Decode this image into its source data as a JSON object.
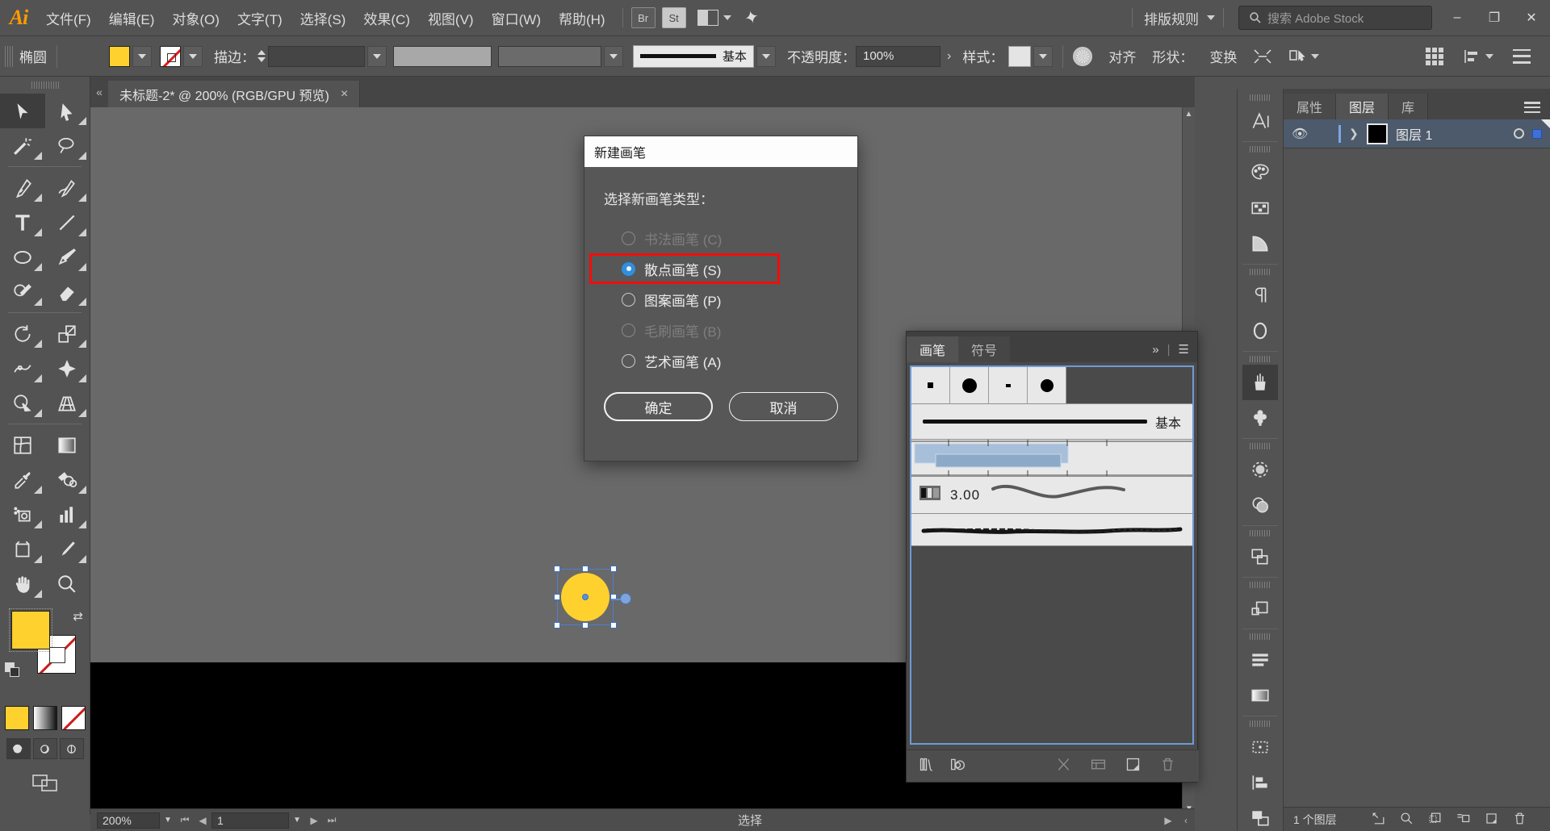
{
  "app": {
    "name": "Adobe Illustrator",
    "logo_text": "Ai",
    "workspace_label": "排版规则",
    "br_badge": "Br",
    "st_badge": "St"
  },
  "menu": {
    "items": [
      {
        "label": "文件(F)"
      },
      {
        "label": "编辑(E)"
      },
      {
        "label": "对象(O)"
      },
      {
        "label": "文字(T)"
      },
      {
        "label": "选择(S)"
      },
      {
        "label": "效果(C)"
      },
      {
        "label": "视图(V)"
      },
      {
        "label": "窗口(W)"
      },
      {
        "label": "帮助(H)"
      }
    ]
  },
  "search": {
    "placeholder": "搜索 Adobe Stock",
    "value": ""
  },
  "window_controls": {
    "minimize": "–",
    "restore": "❐",
    "close": "✕"
  },
  "control_bar": {
    "object_type": "椭圆",
    "fill_color": "#FFD12E",
    "stroke_color": "none",
    "stroke_label": "描边：",
    "stroke_weight": "",
    "brush_name": "基本",
    "opacity_label": "不透明度：",
    "opacity_value": "100%",
    "style_label": "样式：",
    "align_label": "对齐",
    "shape_label": "形状：",
    "transform_label": "变换",
    "expand_arrow": "›"
  },
  "tools": [
    {
      "name": "selection-tool",
      "sel": true
    },
    {
      "name": "direct-selection-tool",
      "sel": false
    },
    {
      "name": "magic-wand-tool",
      "sel": false
    },
    {
      "name": "lasso-tool",
      "sel": false
    },
    {
      "name": "pen-tool",
      "sel": false
    },
    {
      "name": "curvature-tool",
      "sel": false
    },
    {
      "name": "type-tool",
      "sel": false
    },
    {
      "name": "line-segment-tool",
      "sel": false
    },
    {
      "name": "ellipse-tool",
      "sel": false
    },
    {
      "name": "paintbrush-tool",
      "sel": false
    },
    {
      "name": "shaper-tool",
      "sel": false
    },
    {
      "name": "eraser-tool",
      "sel": false
    },
    {
      "name": "rotate-tool",
      "sel": false
    },
    {
      "name": "scale-tool",
      "sel": false
    },
    {
      "name": "width-tool",
      "sel": false
    },
    {
      "name": "free-transform-tool",
      "sel": false
    },
    {
      "name": "shape-builder-tool",
      "sel": false
    },
    {
      "name": "perspective-grid-tool",
      "sel": false
    },
    {
      "name": "mesh-tool",
      "sel": false
    },
    {
      "name": "gradient-tool",
      "sel": false
    },
    {
      "name": "eyedropper-tool",
      "sel": false
    },
    {
      "name": "blend-tool",
      "sel": false
    },
    {
      "name": "symbol-sprayer-tool",
      "sel": false
    },
    {
      "name": "column-graph-tool",
      "sel": false
    },
    {
      "name": "artboard-tool",
      "sel": false
    },
    {
      "name": "slice-tool",
      "sel": false
    },
    {
      "name": "hand-tool",
      "sel": false
    },
    {
      "name": "zoom-tool",
      "sel": false
    }
  ],
  "color_controls": {
    "fill": "#FFD12E",
    "stroke": "none",
    "modes": [
      "color",
      "gradient",
      "none"
    ],
    "draw_modes": [
      "draw-normal",
      "draw-behind",
      "draw-inside"
    ]
  },
  "document": {
    "tab_title": "未标题-2* @ 200% (RGB/GPU 预览)",
    "close_glyph": "×"
  },
  "status_bar": {
    "zoom": "200%",
    "page": "1",
    "tool_status": "选择"
  },
  "right_panel": {
    "tabs": [
      {
        "label": "属性",
        "active": false
      },
      {
        "label": "图层",
        "active": true
      },
      {
        "label": "库",
        "active": false
      }
    ],
    "layers": [
      {
        "name": "图层 1",
        "visible": true,
        "selected": true
      }
    ],
    "footer_count": "1 个图层"
  },
  "brush_panel": {
    "tabs": [
      {
        "label": "画笔",
        "active": true
      },
      {
        "label": "符号",
        "active": false
      }
    ],
    "expand_glyph": "»",
    "menu_glyph": "☰",
    "basic_brush_name": "基本",
    "brush_size": "3.00",
    "scatter_dots": [
      {
        "size": 7,
        "shape": "square"
      },
      {
        "size": 18,
        "shape": "circle"
      },
      {
        "size": 5,
        "shape": "square"
      },
      {
        "size": 16,
        "shape": "circle"
      }
    ]
  },
  "dialog": {
    "title": "新建画笔",
    "prompt": "选择新画笔类型：",
    "options": [
      {
        "label": "书法画笔 (C)",
        "selected": false,
        "disabled": true
      },
      {
        "label": "散点画笔 (S)",
        "selected": true,
        "disabled": false,
        "highlighted": true
      },
      {
        "label": "图案画笔 (P)",
        "selected": false,
        "disabled": false
      },
      {
        "label": "毛刷画笔 (B)",
        "selected": false,
        "disabled": true
      },
      {
        "label": "艺术画笔 (A)",
        "selected": false,
        "disabled": false
      }
    ],
    "ok_label": "确定",
    "cancel_label": "取消",
    "highlight_color": "#f10d0d"
  },
  "canvas": {
    "shape_fill": "#FFD12E",
    "selection_color": "#4e7ecf"
  }
}
